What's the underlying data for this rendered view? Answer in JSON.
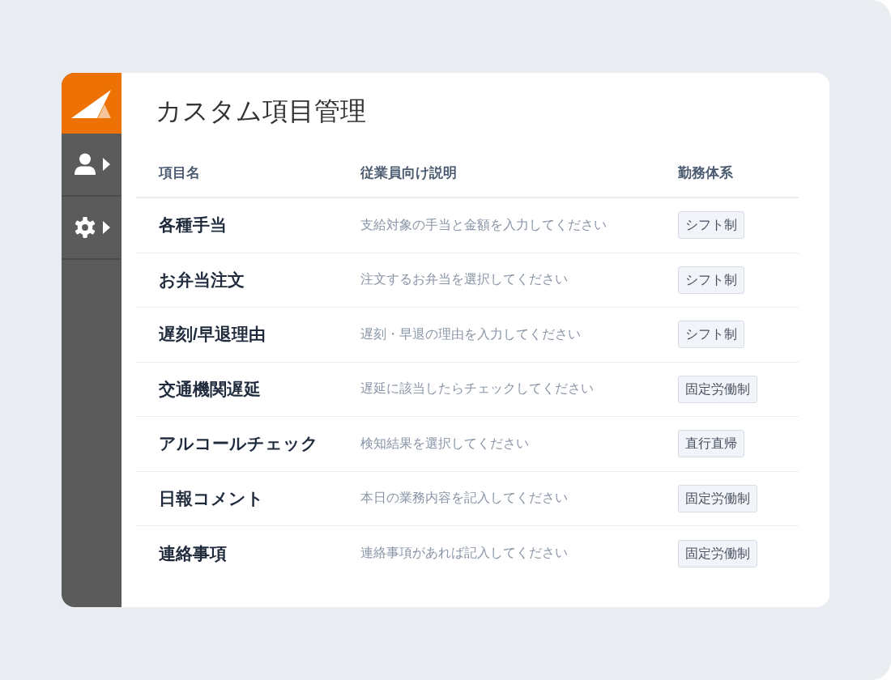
{
  "page": {
    "title": "カスタム項目管理"
  },
  "table": {
    "columns": [
      "項目名",
      "従業員向け説明",
      "勤務体系"
    ],
    "rows": [
      {
        "name": "各種手当",
        "description": "支給対象の手当と金額を入力してください",
        "work_system": "シフト制"
      },
      {
        "name": "お弁当注文",
        "description": "注文するお弁当を選択してください",
        "work_system": "シフト制"
      },
      {
        "name": "遅刻/早退理由",
        "description": "遅刻・早退の理由を入力してください",
        "work_system": "シフト制"
      },
      {
        "name": "交通機関遅延",
        "description": "遅延に該当したらチェックしてください",
        "work_system": "固定労働制"
      },
      {
        "name": "アルコールチェック",
        "description": "検知結果を選択してください",
        "work_system": "直行直帰"
      },
      {
        "name": "日報コメント",
        "description": "本日の業務内容を記入してください",
        "work_system": "固定労働制"
      },
      {
        "name": "連絡事項",
        "description": "連絡事項があれば記入してください",
        "work_system": "固定労働制"
      }
    ]
  }
}
